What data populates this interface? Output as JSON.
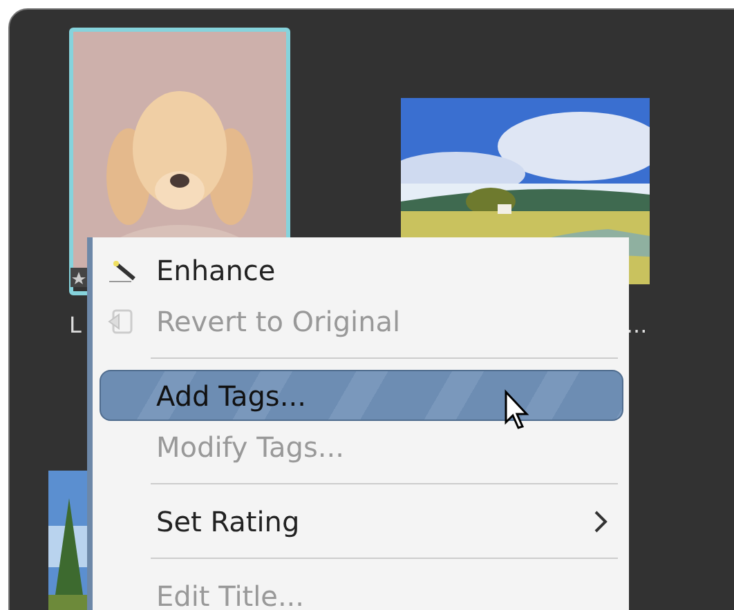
{
  "thumbnails": [
    {
      "kind": "picture",
      "selected": true,
      "caption": "L"
    },
    {
      "kind": "picture",
      "selected": false,
      "caption": "..."
    }
  ],
  "context_menu": {
    "items": [
      {
        "kind": "action",
        "label": "Enhance",
        "disabled": false,
        "selected": false
      },
      {
        "kind": "action",
        "label": "Revert to Original",
        "disabled": true,
        "selected": false
      },
      {
        "kind": "separator"
      },
      {
        "kind": "action",
        "label": "Add Tags...",
        "disabled": false,
        "selected": true
      },
      {
        "kind": "action",
        "label": "Modify Tags...",
        "disabled": true,
        "selected": false
      },
      {
        "kind": "separator"
      },
      {
        "kind": "submenu",
        "label": "Set Rating",
        "disabled": false,
        "selected": false
      },
      {
        "kind": "separator"
      },
      {
        "kind": "action",
        "label": "Edit Title...",
        "disabled": true,
        "selected": false
      }
    ]
  }
}
